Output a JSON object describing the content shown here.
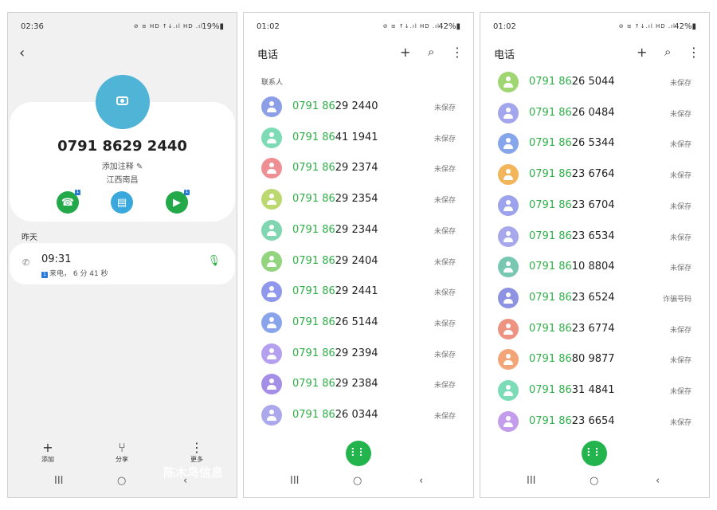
{
  "colors": {
    "highlight": "#2fae48",
    "fab": "#23b44e",
    "avatar_big": "#4fb4d6"
  },
  "detail": {
    "status": {
      "time": "02:36",
      "icons": "⊘ ≡ HD ↑↓.ıl HD .ıl",
      "battery": "19%▮"
    },
    "back_icon": "‹",
    "number": "0791 8629 2440",
    "note": "添加注释 ✎",
    "location": "江西南昌",
    "actions": [
      {
        "name": "call",
        "color": "#23a84a",
        "glyph": "☎",
        "sim": "1"
      },
      {
        "name": "message",
        "color": "#3aa8dc",
        "glyph": "▤",
        "sim": ""
      },
      {
        "name": "video",
        "color": "#23a84a",
        "glyph": "▶",
        "sim": "1"
      }
    ],
    "day_label": "昨天",
    "call": {
      "time": "09:31",
      "detail": "来电， 6 分 41 秒",
      "sim": "1"
    },
    "bottom": [
      {
        "glyph": "+",
        "label": "添加"
      },
      {
        "glyph": "⑂",
        "label": "分享"
      },
      {
        "glyph": "⋮",
        "label": "更多"
      }
    ],
    "watermark": "陈木鸟信息"
  },
  "nav": {
    "recents": "III",
    "home": "○",
    "back": "‹"
  },
  "list1": {
    "status": {
      "time": "01:02",
      "icons": "⊘ ≡ ↑↓.ıl HD .ıl",
      "battery": "42%▮"
    },
    "title": "电话",
    "add": "+",
    "search": "⌕",
    "more": "⋮",
    "section": "联系人",
    "items": [
      {
        "prefix": "0791 86",
        "rest": "29 2440",
        "status": "未保存",
        "color": "#8c9ee6"
      },
      {
        "prefix": "0791 86",
        "rest": "41 1941",
        "status": "未保存",
        "color": "#7ddcb6"
      },
      {
        "prefix": "0791 86",
        "rest": "29 2374",
        "status": "未保存",
        "color": "#ee8f94"
      },
      {
        "prefix": "0791 86",
        "rest": "29 2354",
        "status": "未保存",
        "color": "#bcd870"
      },
      {
        "prefix": "0791 86",
        "rest": "29 2344",
        "status": "未保存",
        "color": "#7fd6b0"
      },
      {
        "prefix": "0791 86",
        "rest": "29 2404",
        "status": "未保存",
        "color": "#92d57e"
      },
      {
        "prefix": "0791 86",
        "rest": "29 2441",
        "status": "未保存",
        "color": "#8f98ea"
      },
      {
        "prefix": "0791 86",
        "rest": "26 5144",
        "status": "未保存",
        "color": "#8aa4ec"
      },
      {
        "prefix": "0791 86",
        "rest": "29 2394",
        "status": "未保存",
        "color": "#b4a0ee"
      },
      {
        "prefix": "0791 86",
        "rest": "29 2384",
        "status": "未保存",
        "color": "#a48ee6"
      },
      {
        "prefix": "0791 86",
        "rest": "26 0344",
        "status": "未保存",
        "color": "#aba8ec"
      }
    ]
  },
  "list2": {
    "status": {
      "time": "01:02",
      "icons": "⊘ ≡ ↑↓.ıl HD .ıl",
      "battery": "42%▮"
    },
    "title": "电话",
    "add": "+",
    "search": "⌕",
    "more": "⋮",
    "items": [
      {
        "prefix": "0791 86",
        "rest": "26 5044",
        "status": "未保存",
        "color": "#9fd672"
      },
      {
        "prefix": "0791 86",
        "rest": "26 0484",
        "status": "未保存",
        "color": "#a3a6ec"
      },
      {
        "prefix": "0791 86",
        "rest": "26 5344",
        "status": "未保存",
        "color": "#86a6ec"
      },
      {
        "prefix": "0791 86",
        "rest": "23 6764",
        "status": "未保存",
        "color": "#f2b55a"
      },
      {
        "prefix": "0791 86",
        "rest": "23 6704",
        "status": "未保存",
        "color": "#9ca2ec"
      },
      {
        "prefix": "0791 86",
        "rest": "23 6534",
        "status": "未保存",
        "color": "#a7a8ec"
      },
      {
        "prefix": "0791 86",
        "rest": "10 8804",
        "status": "未保存",
        "color": "#78c7b0"
      },
      {
        "prefix": "0791 86",
        "rest": "23 6524",
        "status": "诈骗号码",
        "color": "#8e92e2"
      },
      {
        "prefix": "0791 86",
        "rest": "23 6774",
        "status": "未保存",
        "color": "#ee9282"
      },
      {
        "prefix": "0791 86",
        "rest": "80 9877",
        "status": "未保存",
        "color": "#f3a577"
      },
      {
        "prefix": "0791 86",
        "rest": "31 4841",
        "status": "未保存",
        "color": "#7ddcb8"
      },
      {
        "prefix": "0791 86",
        "rest": "23 6654",
        "status": "未保存",
        "color": "#c49cec"
      }
    ]
  },
  "dialpad_icon": "⠇⠇"
}
